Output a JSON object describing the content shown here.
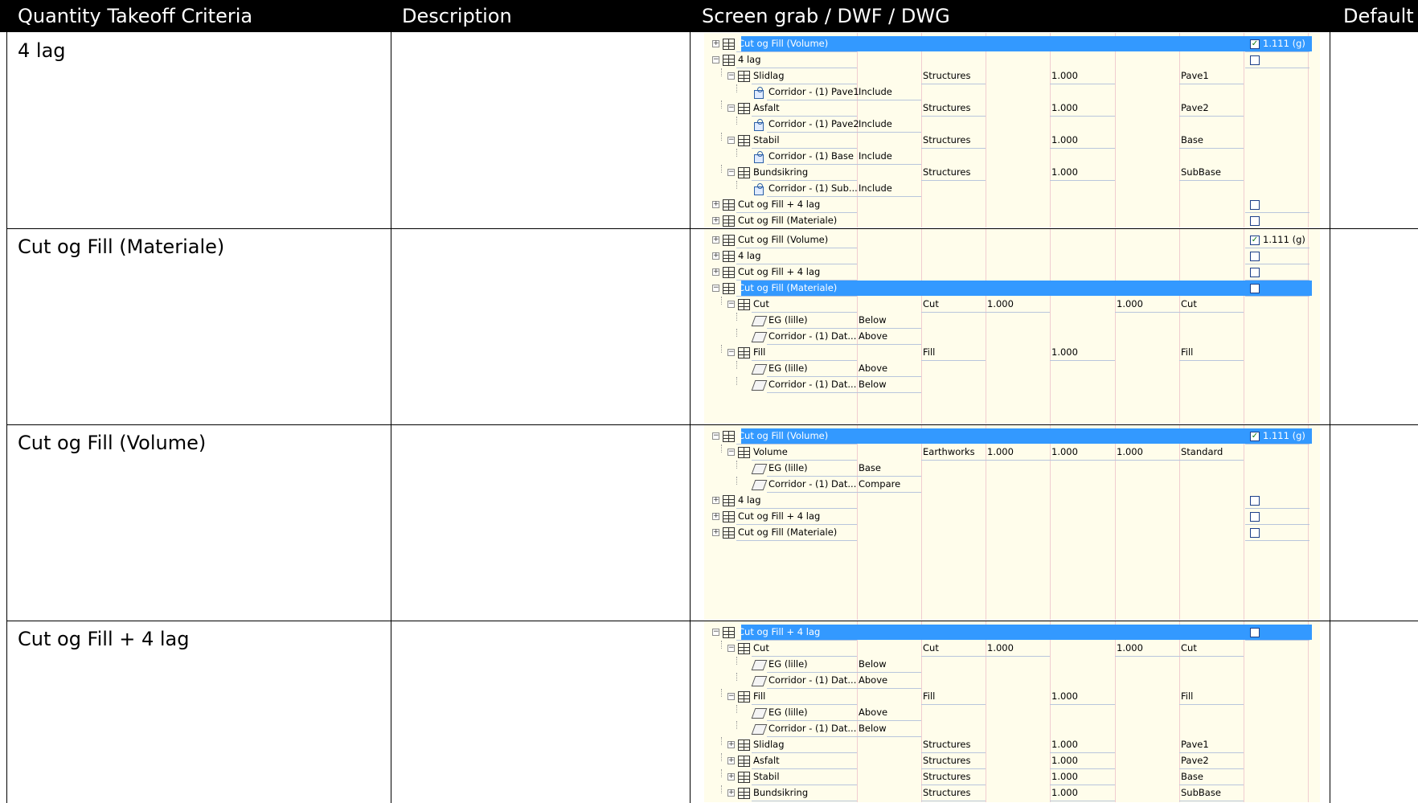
{
  "header": {
    "col1": "Quantity Takeoff Criteria",
    "col2": "Description",
    "col3": "Screen grab / DWF / DWG",
    "col4": "Default"
  },
  "sections": [
    {
      "title": "4 lag",
      "rows": [
        {
          "level": 0,
          "exp": "+",
          "icon": "grid",
          "name": "Cut og Fill (Volume)",
          "selected": true,
          "check": true,
          "checklabel": "1.111 (g)"
        },
        {
          "level": 0,
          "exp": "-",
          "icon": "grid",
          "name": "4 lag",
          "check": false
        },
        {
          "level": 1,
          "exp": "-",
          "icon": "grid",
          "name": "Slidlag",
          "c2": "Structures",
          "c4": "1.000",
          "c6": "Pave1"
        },
        {
          "level": 2,
          "icon": "sub",
          "name": "Corridor - (1) Pave1",
          "c1": "Include"
        },
        {
          "level": 1,
          "exp": "-",
          "icon": "grid",
          "name": "Asfalt",
          "c2": "Structures",
          "c4": "1.000",
          "c6": "Pave2"
        },
        {
          "level": 2,
          "icon": "sub",
          "name": "Corridor - (1) Pave2",
          "c1": "Include"
        },
        {
          "level": 1,
          "exp": "-",
          "icon": "grid",
          "name": "Stabil",
          "c2": "Structures",
          "c4": "1.000",
          "c6": "Base"
        },
        {
          "level": 2,
          "icon": "sub",
          "name": "Corridor - (1) Base",
          "c1": "Include"
        },
        {
          "level": 1,
          "exp": "-",
          "icon": "grid",
          "name": "Bundsikring",
          "c2": "Structures",
          "c4": "1.000",
          "c6": "SubBase"
        },
        {
          "level": 2,
          "icon": "sub",
          "name": "Corridor - (1) Sub...",
          "c1": "Include"
        },
        {
          "level": 0,
          "exp": "+",
          "icon": "grid",
          "name": "Cut og Fill + 4 lag",
          "check": false
        },
        {
          "level": 0,
          "exp": "+",
          "icon": "grid",
          "name": "Cut og Fill (Materiale)",
          "check": false
        }
      ]
    },
    {
      "title": "Cut og Fill (Materiale)",
      "rows": [
        {
          "level": 0,
          "exp": "+",
          "icon": "grid",
          "name": "Cut og Fill (Volume)",
          "check": true,
          "checklabel": "1.111 (g)"
        },
        {
          "level": 0,
          "exp": "+",
          "icon": "grid",
          "name": "4 lag",
          "check": false
        },
        {
          "level": 0,
          "exp": "+",
          "icon": "grid",
          "name": "Cut og Fill + 4 lag",
          "check": false
        },
        {
          "level": 0,
          "exp": "-",
          "icon": "grid",
          "name": "Cut og Fill (Materiale)",
          "selected": true,
          "check": false
        },
        {
          "level": 1,
          "exp": "-",
          "icon": "grid",
          "name": "Cut",
          "c2": "Cut",
          "c3": "1.000",
          "c5": "1.000",
          "c6": "Cut"
        },
        {
          "level": 2,
          "icon": "surf",
          "name": "EG (lille)",
          "c1": "Below"
        },
        {
          "level": 2,
          "icon": "surf",
          "name": "Corridor - (1) Dat...",
          "c1": "Above"
        },
        {
          "level": 1,
          "exp": "-",
          "icon": "grid",
          "name": "Fill",
          "c2": "Fill",
          "c4": "1.000",
          "c6": "Fill"
        },
        {
          "level": 2,
          "icon": "surf",
          "name": "EG (lille)",
          "c1": "Above"
        },
        {
          "level": 2,
          "icon": "surf",
          "name": "Corridor - (1) Dat...",
          "c1": "Below"
        }
      ]
    },
    {
      "title": "Cut og Fill (Volume)",
      "rows": [
        {
          "level": 0,
          "exp": "-",
          "icon": "grid",
          "name": "Cut og Fill (Volume)",
          "selected": true,
          "check": true,
          "checklabel": "1.111 (g)"
        },
        {
          "level": 1,
          "exp": "-",
          "icon": "grid",
          "name": "Volume",
          "c2": "Earthworks",
          "c3": "1.000",
          "c4": "1.000",
          "c5": "1.000",
          "c6": "Standard"
        },
        {
          "level": 2,
          "icon": "surf",
          "name": "EG (lille)",
          "c1": "Base"
        },
        {
          "level": 2,
          "icon": "surf",
          "name": "Corridor - (1) Dat...",
          "c1": "Compare"
        },
        {
          "level": 0,
          "exp": "+",
          "icon": "grid",
          "name": "4 lag",
          "check": false
        },
        {
          "level": 0,
          "exp": "+",
          "icon": "grid",
          "name": "Cut og Fill + 4 lag",
          "check": false
        },
        {
          "level": 0,
          "exp": "+",
          "icon": "grid",
          "name": "Cut og Fill (Materiale)",
          "check": false
        }
      ]
    },
    {
      "title": "Cut og Fill + 4 lag",
      "rows": [
        {
          "level": 0,
          "exp": "-",
          "icon": "grid",
          "name": "Cut og Fill + 4 lag",
          "selected": true,
          "check": false
        },
        {
          "level": 1,
          "exp": "-",
          "icon": "grid",
          "name": "Cut",
          "c2": "Cut",
          "c3": "1.000",
          "c5": "1.000",
          "c6": "Cut"
        },
        {
          "level": 2,
          "icon": "surf",
          "name": "EG (lille)",
          "c1": "Below"
        },
        {
          "level": 2,
          "icon": "surf",
          "name": "Corridor - (1) Dat...",
          "c1": "Above"
        },
        {
          "level": 1,
          "exp": "-",
          "icon": "grid",
          "name": "Fill",
          "c2": "Fill",
          "c4": "1.000",
          "c6": "Fill"
        },
        {
          "level": 2,
          "icon": "surf",
          "name": "EG (lille)",
          "c1": "Above"
        },
        {
          "level": 2,
          "icon": "surf",
          "name": "Corridor - (1) Dat...",
          "c1": "Below"
        },
        {
          "level": 1,
          "exp": "+",
          "icon": "grid",
          "name": "Slidlag",
          "c2": "Structures",
          "c4": "1.000",
          "c6": "Pave1"
        },
        {
          "level": 1,
          "exp": "+",
          "icon": "grid",
          "name": "Asfalt",
          "c2": "Structures",
          "c4": "1.000",
          "c6": "Pave2"
        },
        {
          "level": 1,
          "exp": "+",
          "icon": "grid",
          "name": "Stabil",
          "c2": "Structures",
          "c4": "1.000",
          "c6": "Base"
        },
        {
          "level": 1,
          "exp": "+",
          "icon": "grid",
          "name": "Bundsikring",
          "c2": "Structures",
          "c4": "1.000",
          "c6": "SubBase"
        }
      ]
    }
  ]
}
